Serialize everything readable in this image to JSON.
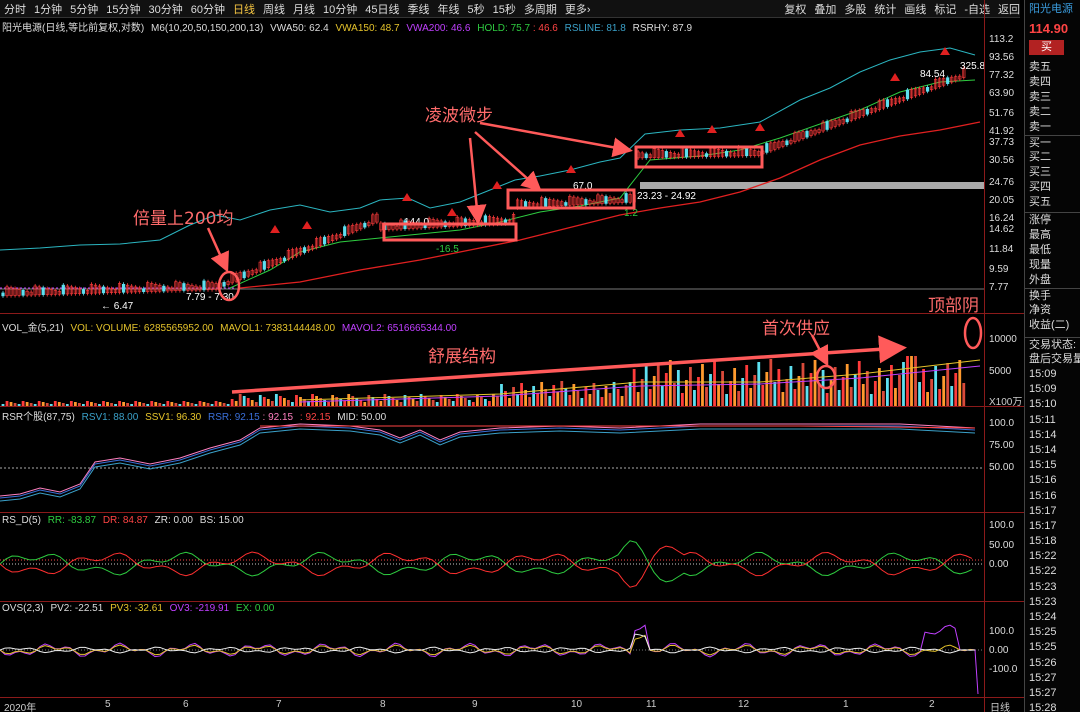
{
  "toolbar": {
    "periods": [
      "分时",
      "1分钟",
      "5分钟",
      "15分钟",
      "30分钟",
      "60分钟",
      "日线",
      "周线",
      "月线",
      "10分钟",
      "45日线",
      "季线",
      "年线",
      "5秒",
      "15秒",
      "多周期",
      "更多›"
    ],
    "active_index": 6,
    "right_items": [
      "复权",
      "叠加",
      "多股",
      "统计",
      "画线",
      "标记",
      "-自选",
      "返回"
    ]
  },
  "main_panel": {
    "title": "阳光电源(日线,等比前复权,对数)",
    "indicator": "M6(10,20,50,150,200,13)",
    "vwa50": "VWA50: 62.4",
    "vwa150": "VWA150: 48.7",
    "vwa200": "VWA200: 46.6",
    "hold": "HOLD: 75.7",
    "hold2": ": 46.6",
    "rsline": "RSLINE: 81.8",
    "rsrhy": "RSRHY: 87.9",
    "y_axis": [
      "113.2",
      "93.56",
      "77.32",
      "63.90",
      "51.76",
      "41.92",
      "37.73",
      "30.56",
      "24.76",
      "20.05",
      "16.24",
      "14.62",
      "11.84",
      "9.59",
      "7.77"
    ],
    "price_labels": {
      "p1": "6.47",
      "p2": "7.79 - 7.30",
      "p3": "144.0",
      "p4": "-16.5",
      "p5": "67.0",
      "p6": "23.23 - 24.92",
      "p7": "84.54",
      "p8": "325.8",
      "p9": "1.2"
    }
  },
  "vol_panel": {
    "title": "VOL_金(5,21)",
    "vol": "VOL: VOLUME: 6285565952.00",
    "mavol1": "MAVOL1: 7383144448.00",
    "mavol2": "MAVOL2: 6516665344.00",
    "y_axis": [
      "10000",
      "5000"
    ],
    "unit": "X100万"
  },
  "rsr_panel": {
    "title": "RSR个股(87,75)",
    "rsv1": "RSV1: 88.00",
    "ssv1": "SSV1: 96.30",
    "rsr": "RSR: 92.15",
    "rsr2": ": 92.15",
    "rsr3": ": 92.15",
    "mid": "MID: 50.00",
    "y_axis": [
      "100.0",
      "75.00",
      "50.00"
    ]
  },
  "rsd_panel": {
    "title": "RS_D(5)",
    "rr": "RR: -83.87",
    "dr": "DR: 84.87",
    "zr": "ZR: 0.00",
    "bs": "BS: 15.00",
    "y_axis": [
      "100.0",
      "50.00",
      "0.00"
    ]
  },
  "ovs_panel": {
    "title": "OVS(2,3)",
    "pv2": "PV2: -22.51",
    "pv3": "PV3: -32.61",
    "ov3": "OV3: -219.91",
    "ex": "EX: 0.00",
    "y_axis": [
      "100.0",
      "0.00",
      "-100.0"
    ]
  },
  "x_axis": [
    "2020年",
    "5",
    "6",
    "7",
    "8",
    "9",
    "10",
    "11",
    "12",
    "1",
    "2"
  ],
  "x_axis_right": "日线",
  "annotations": {
    "a1": "倍量上200均",
    "a2": "凌波微步",
    "a3": "舒展结构",
    "a4": "首次供应",
    "a5": "顶部阴"
  },
  "right_panel": {
    "stock_name": "阳光电源",
    "price": "114.90",
    "buy_btn": "买",
    "order_book": [
      "卖五",
      "卖四",
      "卖三",
      "卖二",
      "卖一",
      "买一",
      "买二",
      "买三",
      "买四",
      "买五"
    ],
    "stats": [
      "涨停",
      "最高",
      "最低",
      "现量",
      "外盘",
      "换手",
      "净资",
      "收益(二)"
    ],
    "status": "交易状态: 闭",
    "after": "盘后交易量",
    "times": [
      "15:09",
      "15:09",
      "15:10",
      "15:11",
      "15:14",
      "15:14",
      "15:15",
      "15:16",
      "15:16",
      "15:17",
      "15:17",
      "15:18",
      "15:22",
      "15:22",
      "15:23",
      "15:23",
      "15:24",
      "15:25",
      "15:25",
      "15:26",
      "15:27",
      "15:27",
      "15:28"
    ]
  }
}
